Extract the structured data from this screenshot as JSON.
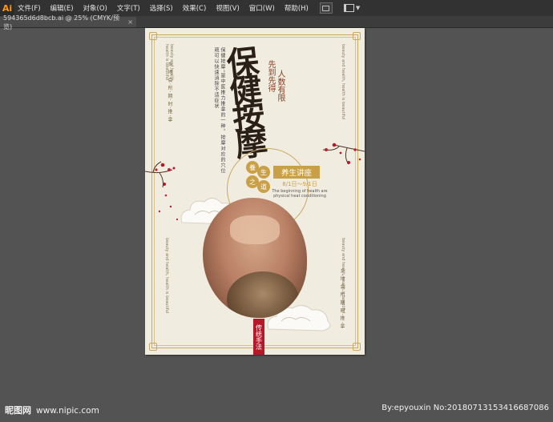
{
  "menubar": {
    "app_logo": "Ai",
    "items": [
      "文件(F)",
      "编辑(E)",
      "对象(O)",
      "文字(T)",
      "选择(S)",
      "效果(C)",
      "视图(V)",
      "窗口(W)",
      "帮助(H)"
    ]
  },
  "tab": {
    "title": "594365d6d8bcb.ai @ 25% (CMYK/预览)",
    "close": "×"
  },
  "poster": {
    "title": "保健按摩",
    "slogan_a": "人数有限",
    "slogan_b": "先到先得",
    "side_text": "保健按摩”是中医推力推拿的一种，按摩对应的穴位疏可以快速消除不适症状",
    "badge_1": "養",
    "badge_2": "生",
    "badge_3": "之",
    "badge_4": "道",
    "lecture": "养生讲座",
    "date": "8/1日～9/1日",
    "english": "The beginning of health are physical heat conditioning",
    "left_poem": "乡·地·会·所·期·时·推·拿",
    "right_poem": "乡·地·会·所·期·时·推·拿",
    "seal": "传统手法",
    "small_vert_1": "beauty and health, health is beautiful",
    "small_vert_2": "beauty and health, health is beautiful",
    "small_vert_3": "beauty and health, health is beautiful",
    "small_vert_4": "beauty and health, health is beautiful"
  },
  "watermark": {
    "site": "昵图网",
    "url": "www.nipic.com",
    "info": "By:epyouxin No:20180713153416687086"
  },
  "colors": {
    "canvas_bg": "#535353",
    "menubar_bg": "#323232",
    "poster_bg": "#f1ece0",
    "gold": "#c9a046",
    "seal_red": "#b6182a"
  }
}
